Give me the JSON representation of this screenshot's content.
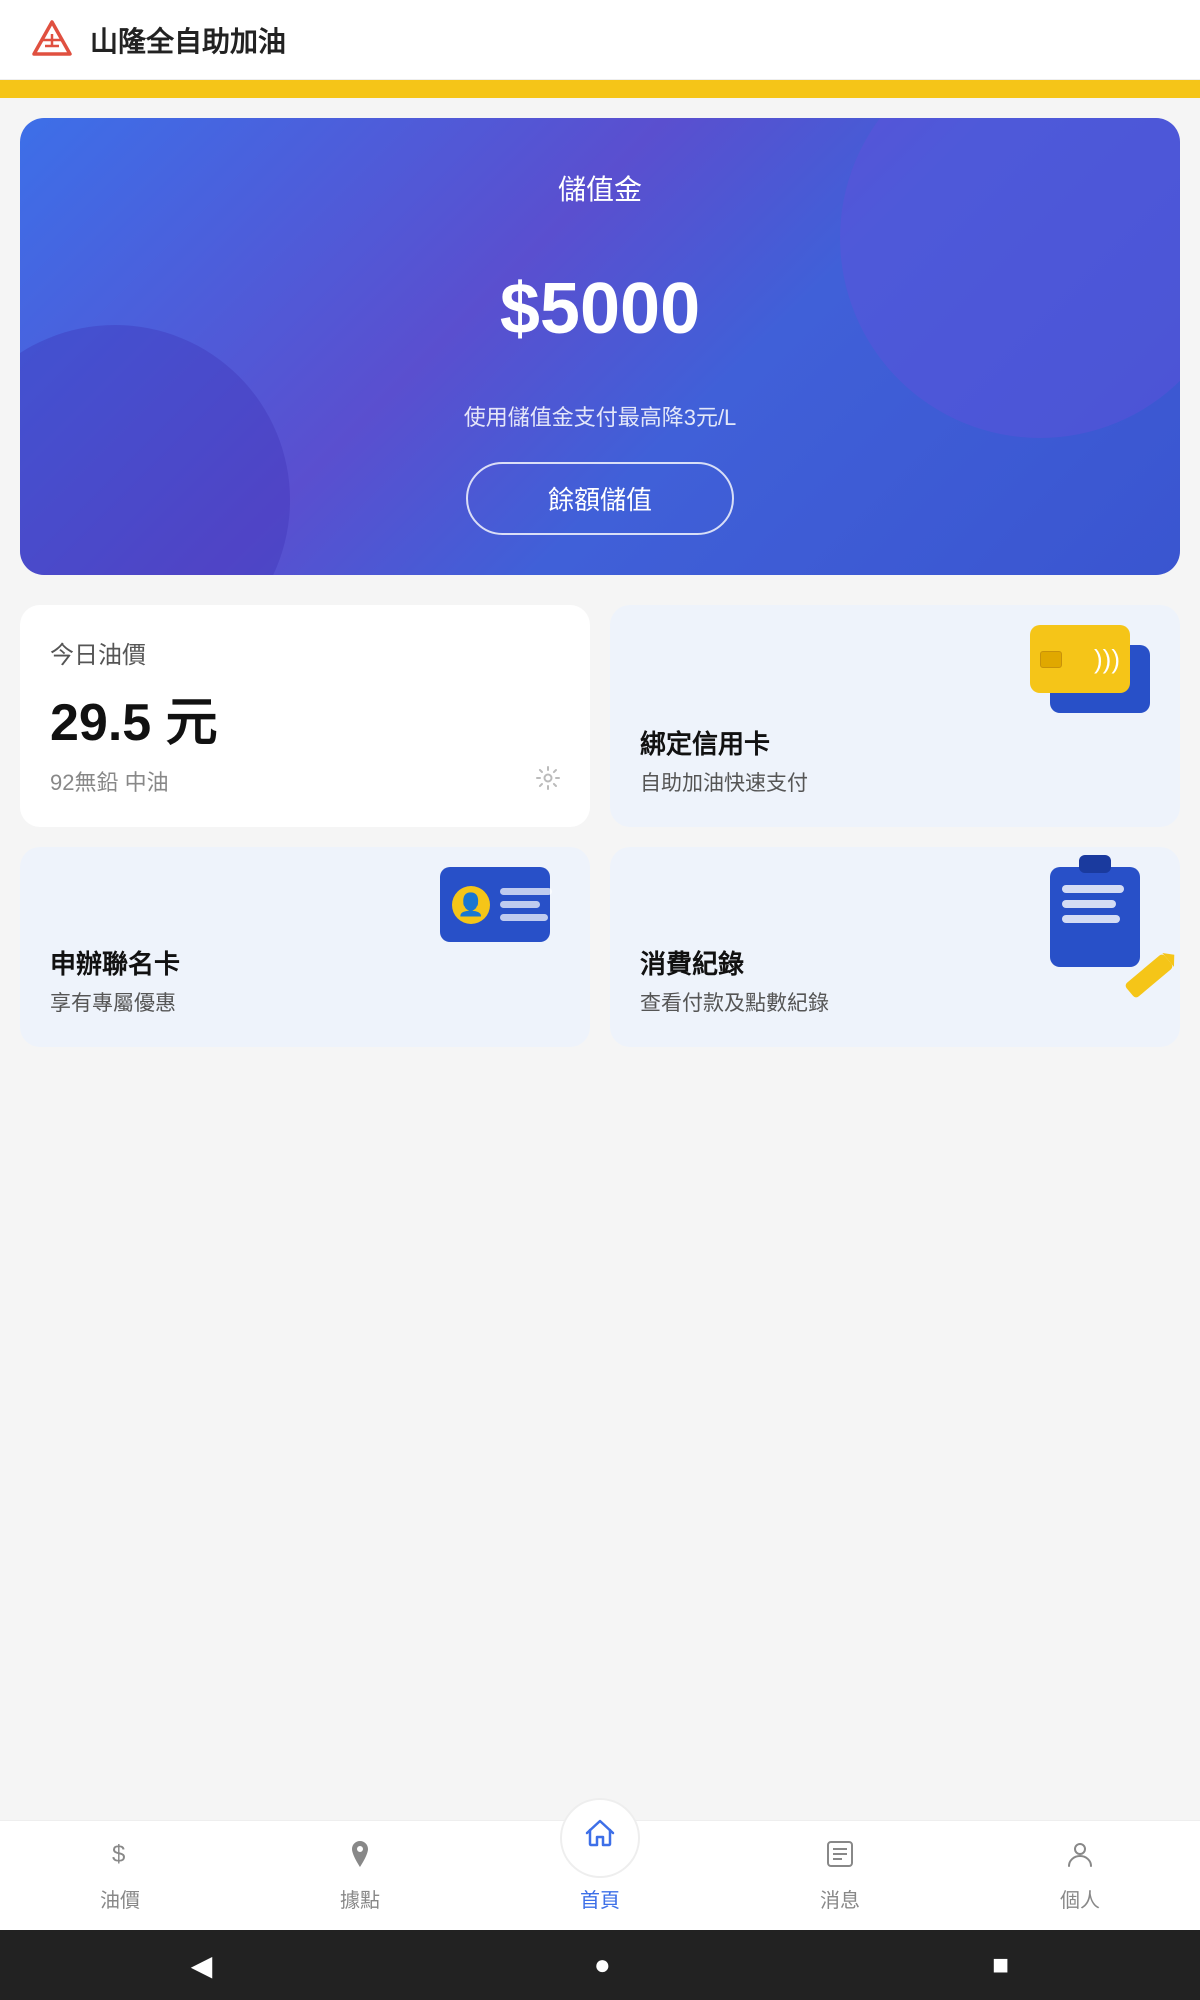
{
  "app": {
    "title": "山隆全自助加油"
  },
  "balance_card": {
    "label": "儲值金",
    "amount": "$5000",
    "note": "使用儲值金支付最高降3元/L",
    "btn_label": "餘額儲值"
  },
  "oil_price": {
    "section_label": "今日油價",
    "value": "29.5 元",
    "sub": "92無鉛 中油"
  },
  "credit_card": {
    "title": "綁定信用卡",
    "sub": "自助加油快速支付"
  },
  "membership": {
    "title": "申辦聯名卡",
    "sub": "享有專屬優惠"
  },
  "records": {
    "title": "消費紀錄",
    "sub": "查看付款及點數紀錄"
  },
  "nav": {
    "oil": "油價",
    "points": "據點",
    "home": "首頁",
    "news": "消息",
    "profile": "個人"
  },
  "android": {
    "back": "◀",
    "home": "●",
    "recent": "■"
  }
}
